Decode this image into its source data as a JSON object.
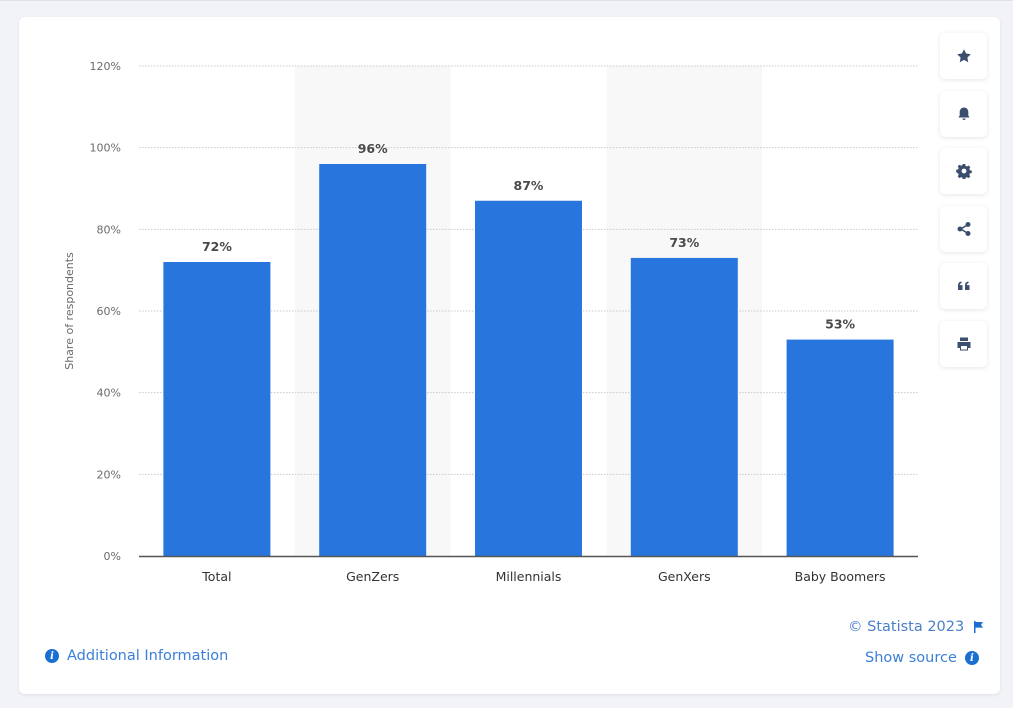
{
  "chart_data": {
    "type": "bar",
    "title": "",
    "xlabel": "",
    "ylabel": "Share of respondents",
    "categories": [
      "Total",
      "GenZers",
      "Millennials",
      "GenXers",
      "Baby Boomers"
    ],
    "values": [
      72,
      96,
      87,
      73,
      53
    ],
    "data_labels": [
      "72%",
      "96%",
      "87%",
      "73%",
      "53%"
    ],
    "ylim": [
      0,
      120
    ],
    "yticks": [
      0,
      20,
      40,
      60,
      80,
      100,
      120
    ],
    "ytick_labels": [
      "0%",
      "20%",
      "40%",
      "60%",
      "80%",
      "100%",
      "120%"
    ],
    "grid": true,
    "legend": "none",
    "bar_color": "#2876dd",
    "alternate_band_color": "#f8f8f8"
  },
  "actions": {
    "favorite": "star-icon",
    "notify": "bell-icon",
    "settings": "gear-icon",
    "share": "share-icon",
    "cite": "quote-icon",
    "print": "print-icon"
  },
  "footer": {
    "additional_info": "Additional Information",
    "copyright": "© Statista 2023",
    "show_source": "Show source",
    "info_glyph": "i"
  },
  "colors": {
    "link": "#3a7fd8",
    "accent": "#1a6fd1",
    "icon": "#3a4f6e"
  }
}
